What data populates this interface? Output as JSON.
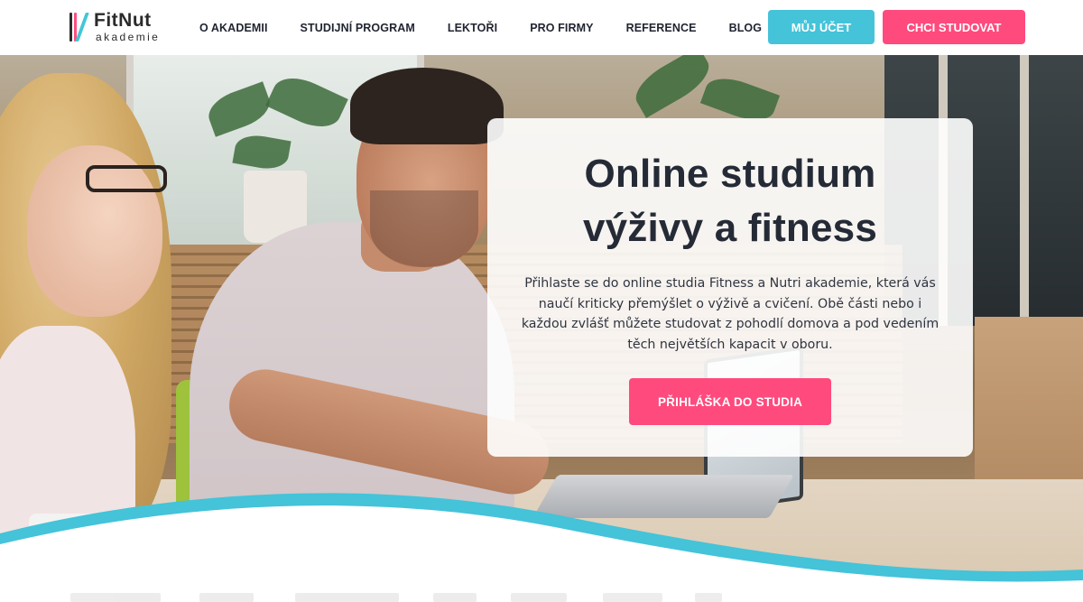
{
  "header": {
    "logo": {
      "name": "FitNut",
      "sub": "akademie"
    },
    "nav": [
      {
        "label": "O AKADEMII"
      },
      {
        "label": "STUDIJNÍ PROGRAM"
      },
      {
        "label": "LEKTOŘI"
      },
      {
        "label": "PRO FIRMY"
      },
      {
        "label": "REFERENCE"
      },
      {
        "label": "BLOG"
      }
    ],
    "account_button": "MŮJ ÚČET",
    "study_button": "CHCI STUDOVAT"
  },
  "hero": {
    "title_line1": "Online studium",
    "title_line2": "výživy a fitness",
    "text": "Přihlaste se do online studia Fitness a Nutri akademie, která vás naučí kriticky přemýšlet o výživě a cvičení. Obě části nebo i každou zvlášť můžete studovat z pohodlí domova a pod vedením těch největších kapacit v oboru.",
    "cta": "PŘIHLÁŠKA DO STUDIA"
  },
  "colors": {
    "accent_pink": "#ff4a7d",
    "accent_teal": "#44c3d9",
    "text_dark": "#1f2430"
  },
  "icons": {
    "logo_mark": "fitnut-logo-icon"
  }
}
